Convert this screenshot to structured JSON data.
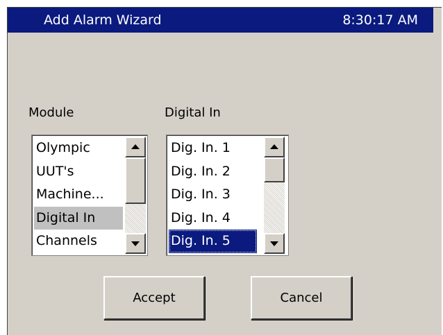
{
  "window": {
    "title": "Add Alarm Wizard",
    "time": "8:30:17 AM"
  },
  "module": {
    "label": "Module",
    "items": [
      "Olympic",
      "UUT's",
      "Machine...",
      "Digital In",
      "Channels"
    ],
    "selected": "Digital In"
  },
  "digital_in": {
    "label": "Digital In",
    "items": [
      "Dig. In. 1",
      "Dig. In. 2",
      "Dig. In. 3",
      "Dig. In. 4",
      "Dig. In. 5"
    ],
    "selected": "Dig. In. 5"
  },
  "buttons": {
    "accept": "Accept",
    "cancel": "Cancel"
  },
  "colors": {
    "titlebar": "#0a1a7e",
    "background": "#d4d0c8",
    "selection": "#0a1a7e"
  },
  "icons": {
    "scroll_up": "scroll-up-arrow-icon",
    "scroll_down": "scroll-down-arrow-icon"
  }
}
